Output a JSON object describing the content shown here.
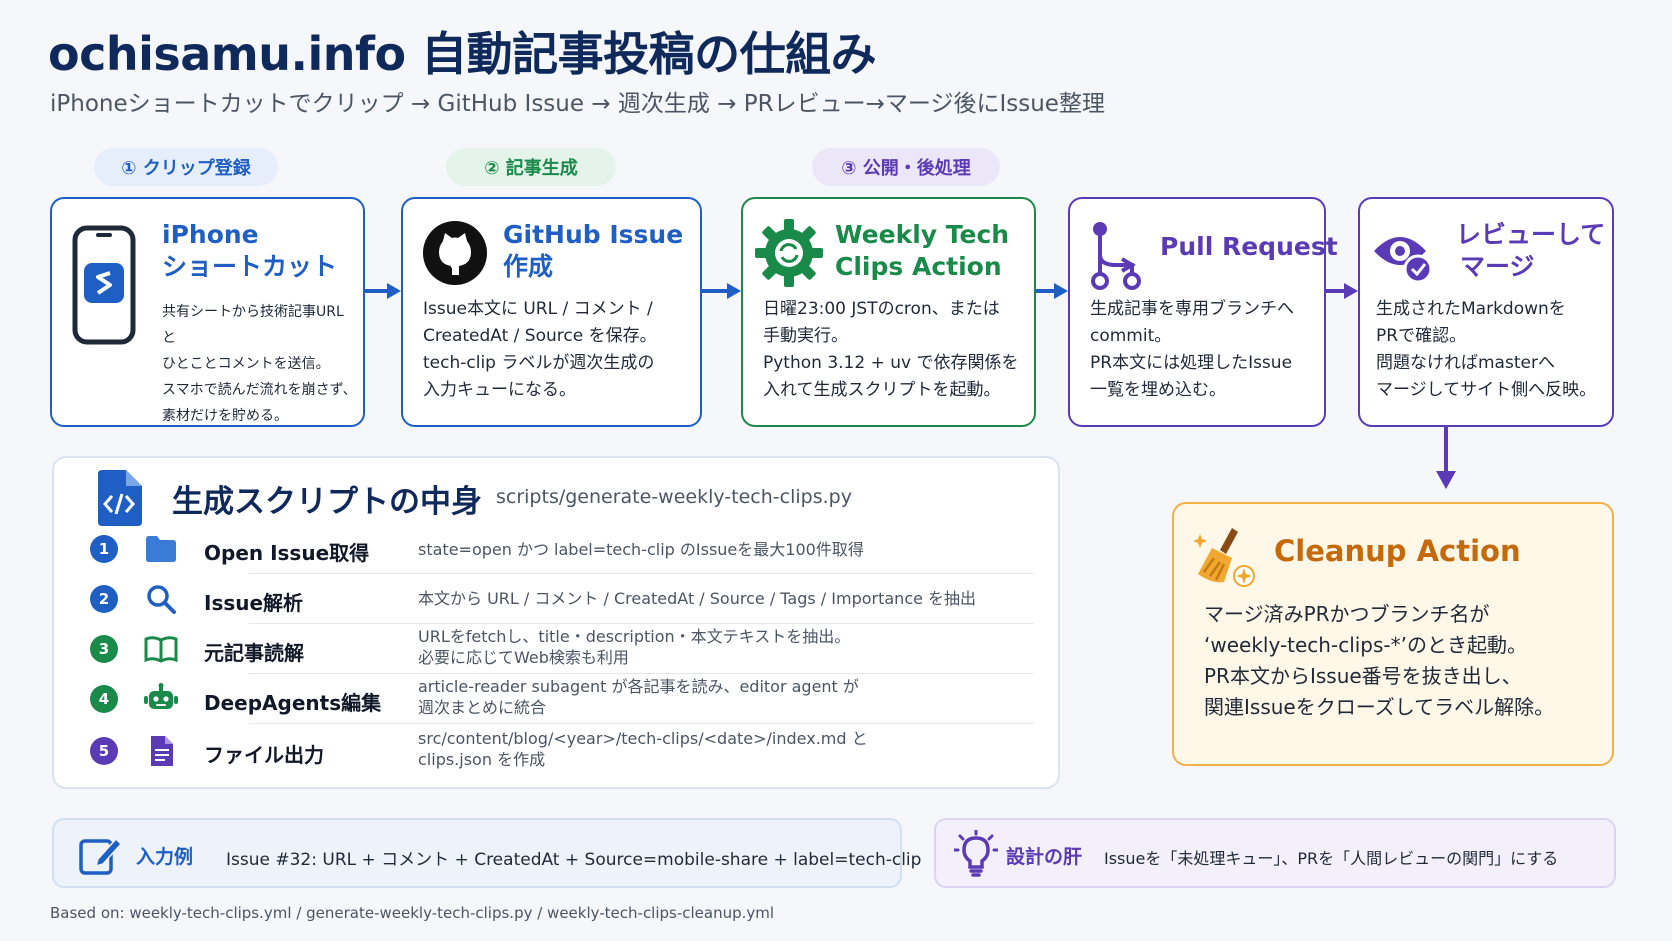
{
  "header": {
    "title": "ochisamu.info 自動記事投稿の仕組み",
    "subtitle": "iPhoneショートカットでクリップ → GitHub Issue → 週次生成 → PRレビュー→マージ後にIssue整理"
  },
  "phases": [
    {
      "label": "① クリップ登録"
    },
    {
      "label": "② 記事生成"
    },
    {
      "label": "③ 公開・後処理"
    }
  ],
  "cards": [
    {
      "title_line1": "iPhone",
      "title_line2": "ショートカット",
      "body": [
        "共有シートから技術記事URLと",
        "ひとことコメントを送信。",
        "スマホで読んだ流れを崩さず、",
        "素材だけを貯める。"
      ]
    },
    {
      "title_line1": "GitHub Issue",
      "title_line2": "作成",
      "body": [
        "Issue本文に URL / コメント /",
        "CreatedAt / Source を保存。",
        "tech-clip ラベルが週次生成の",
        "入力キューになる。"
      ]
    },
    {
      "title_line1": "Weekly Tech",
      "title_line2": "Clips Action",
      "body": [
        "日曜23:00 JSTのcron、または",
        "手動実行。",
        "Python 3.12 + uv で依存関係を",
        "入れて生成スクリプトを起動。"
      ]
    },
    {
      "title_line1": "Pull Request",
      "title_line2": "",
      "body": [
        "生成記事を専用ブランチへ",
        "commit。",
        "PR本文には処理したIssue",
        "一覧を埋め込む。"
      ]
    },
    {
      "title_line1": "レビューして",
      "title_line2": "マージ",
      "body": [
        "生成されたMarkdownを",
        "PRで確認。",
        "問題なければmasterへ",
        "マージしてサイト側へ反映。"
      ]
    }
  ],
  "script_panel": {
    "title": "生成スクリプトの中身",
    "path": "scripts/generate-weekly-tech-clips.py",
    "steps": [
      {
        "num": "1",
        "label": "Open Issue取得",
        "icon": "folder-icon",
        "desc1": "state=open かつ label=tech-clip のIssueを最大100件取得",
        "desc2": ""
      },
      {
        "num": "2",
        "label": "Issue解析",
        "icon": "search-icon",
        "desc1": "本文から URL / コメント / CreatedAt / Source / Tags / Importance を抽出",
        "desc2": ""
      },
      {
        "num": "3",
        "label": "元記事読解",
        "icon": "book-icon",
        "desc1": "URLをfetchし、title・description・本文テキストを抽出。",
        "desc2": "必要に応じてWeb検索も利用"
      },
      {
        "num": "4",
        "label": "DeepAgents編集",
        "icon": "robot-icon",
        "desc1": "article-reader subagent が各記事を読み、editor agent が",
        "desc2": "週次まとめに統合"
      },
      {
        "num": "5",
        "label": "ファイル出力",
        "icon": "document-icon",
        "desc1": "src/content/blog/<year>/tech-clips/<date>/index.md と",
        "desc2": "clips.json を作成"
      }
    ]
  },
  "cleanup": {
    "title": "Cleanup Action",
    "lines": [
      "マージ済みPRかつブランチ名が",
      "‘weekly-tech-clips-*’のとき起動。",
      "PR本文からIssue番号を抜き出し、",
      "関連Issueをクローズしてラベル解除。"
    ]
  },
  "bottom": {
    "input_label": "入力例",
    "input_text": "Issue #32: URL + コメント + CreatedAt + Source=mobile-share + label=tech-clip",
    "design_label": "設計の肝",
    "design_text": "Issueを「未処理キュー」、PRを「人間レビューの関門」にする"
  },
  "footer": "Based on: weekly-tech-clips.yml / generate-weekly-tech-clips.py / weekly-tech-clips-cleanup.yml",
  "colors": {
    "blue": "#1f5fc4",
    "green": "#1a8a4a",
    "purple": "#5b3bb5",
    "orange": "#f2b04a",
    "navy": "#0f2a5a"
  }
}
